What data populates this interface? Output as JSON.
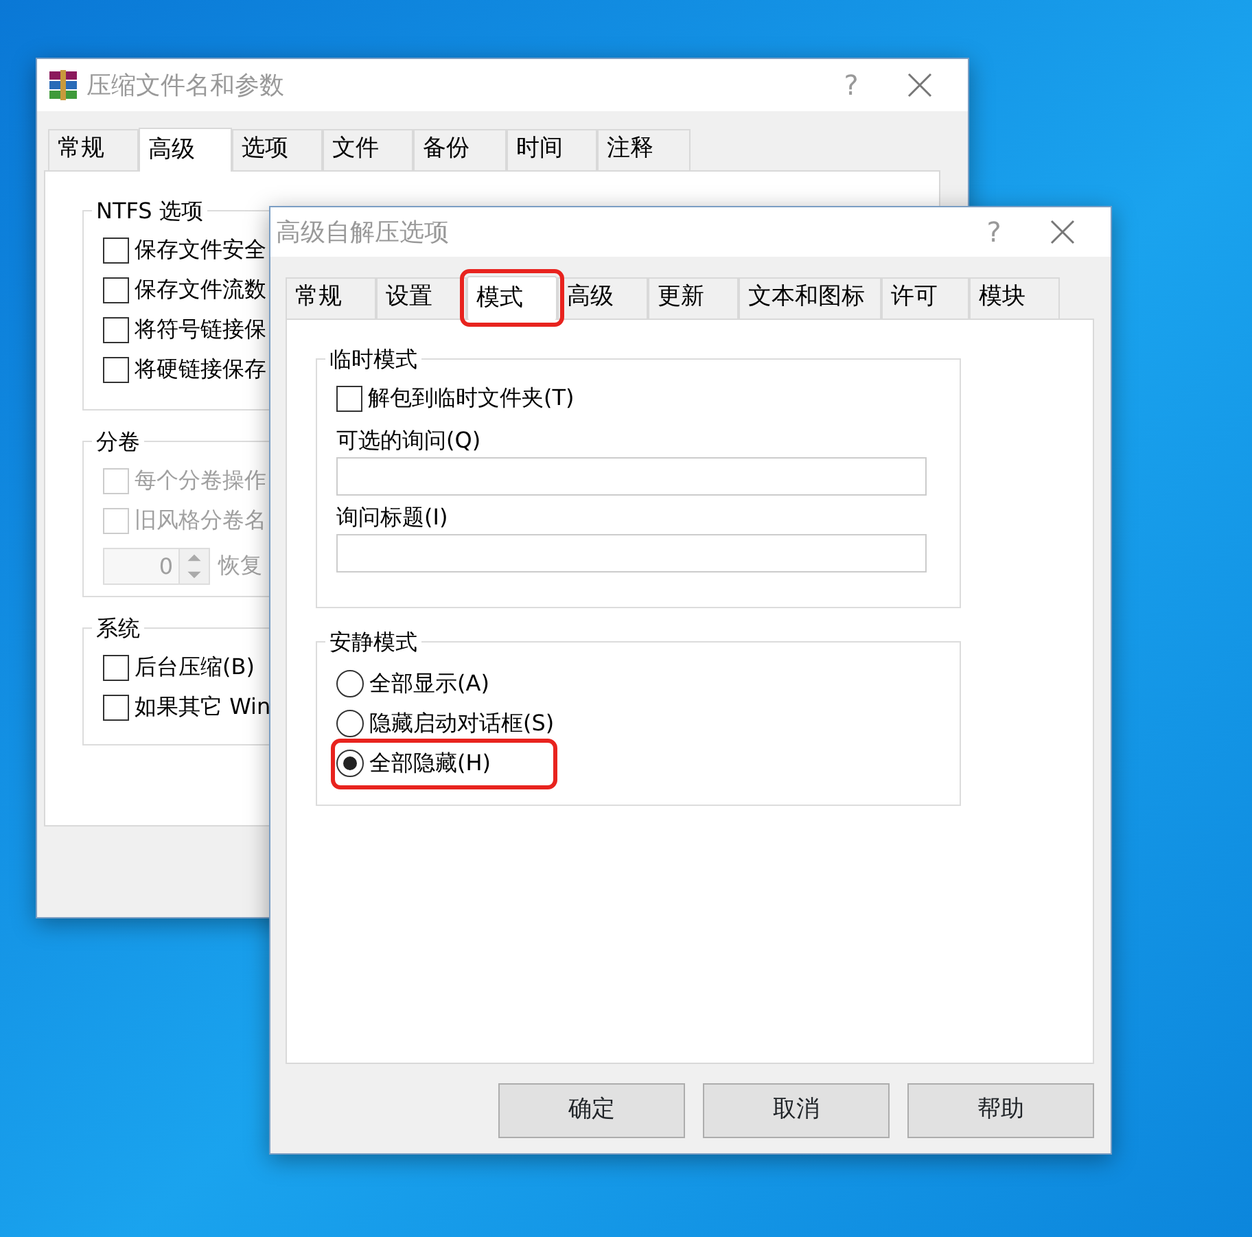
{
  "back_window": {
    "title": "压缩文件名和参数",
    "help": "?",
    "tabs": [
      {
        "label": "常规",
        "selected": false
      },
      {
        "label": "高级",
        "selected": true
      },
      {
        "label": "选项",
        "selected": false
      },
      {
        "label": "文件",
        "selected": false
      },
      {
        "label": "备份",
        "selected": false
      },
      {
        "label": "时间",
        "selected": false
      },
      {
        "label": "注释",
        "selected": false
      }
    ],
    "groups": [
      {
        "title": "NTFS 选项",
        "items": [
          {
            "kind": "checkbox",
            "label": "保存文件安全",
            "checked": false,
            "disabled": false
          },
          {
            "kind": "checkbox",
            "label": "保存文件流数",
            "checked": false,
            "disabled": false
          },
          {
            "kind": "checkbox",
            "label": "将符号链接保",
            "checked": false,
            "disabled": false
          },
          {
            "kind": "checkbox",
            "label": "将硬链接保存",
            "checked": false,
            "disabled": false
          }
        ]
      },
      {
        "title": "分卷",
        "items": [
          {
            "kind": "checkbox",
            "label": "每个分卷操作",
            "checked": false,
            "disabled": true
          },
          {
            "kind": "checkbox",
            "label": "旧风格分卷名",
            "checked": false,
            "disabled": true
          },
          {
            "kind": "spinner",
            "value": "0",
            "label": "恢复",
            "disabled": true
          }
        ]
      },
      {
        "title": "系统",
        "items": [
          {
            "kind": "checkbox",
            "label": "后台压缩(B)",
            "checked": false,
            "disabled": false
          },
          {
            "kind": "checkbox",
            "label": "如果其它 Win",
            "checked": false,
            "disabled": false
          }
        ]
      }
    ]
  },
  "dialog": {
    "title": "高级自解压选项",
    "help": "?",
    "tabs": [
      {
        "label": "常规",
        "selected": false,
        "highlighted": false
      },
      {
        "label": "设置",
        "selected": false,
        "highlighted": false
      },
      {
        "label": "模式",
        "selected": true,
        "highlighted": true
      },
      {
        "label": "高级",
        "selected": false,
        "highlighted": false
      },
      {
        "label": "更新",
        "selected": false,
        "highlighted": false
      },
      {
        "label": "文本和图标",
        "selected": false,
        "highlighted": false
      },
      {
        "label": "许可",
        "selected": false,
        "highlighted": false
      },
      {
        "label": "模块",
        "selected": false,
        "highlighted": false
      }
    ],
    "groups": [
      {
        "title": "临时模式",
        "items": [
          {
            "kind": "checkbox",
            "label": "解包到临时文件夹(T)",
            "checked": false,
            "disabled": false
          },
          {
            "kind": "field",
            "label": "可选的询问(Q)"
          },
          {
            "kind": "field",
            "label": "询问标题(I)"
          }
        ]
      },
      {
        "title": "安静模式",
        "items": [
          {
            "kind": "radio",
            "label": "全部显示(A)",
            "selected": false,
            "highlighted": false
          },
          {
            "kind": "radio",
            "label": "隐藏启动对话框(S)",
            "selected": false,
            "highlighted": false
          },
          {
            "kind": "radio",
            "label": "全部隐藏(H)",
            "selected": true,
            "highlighted": true
          }
        ]
      }
    ]
  },
  "buttons": [
    "确定",
    "取消",
    "帮助"
  ]
}
